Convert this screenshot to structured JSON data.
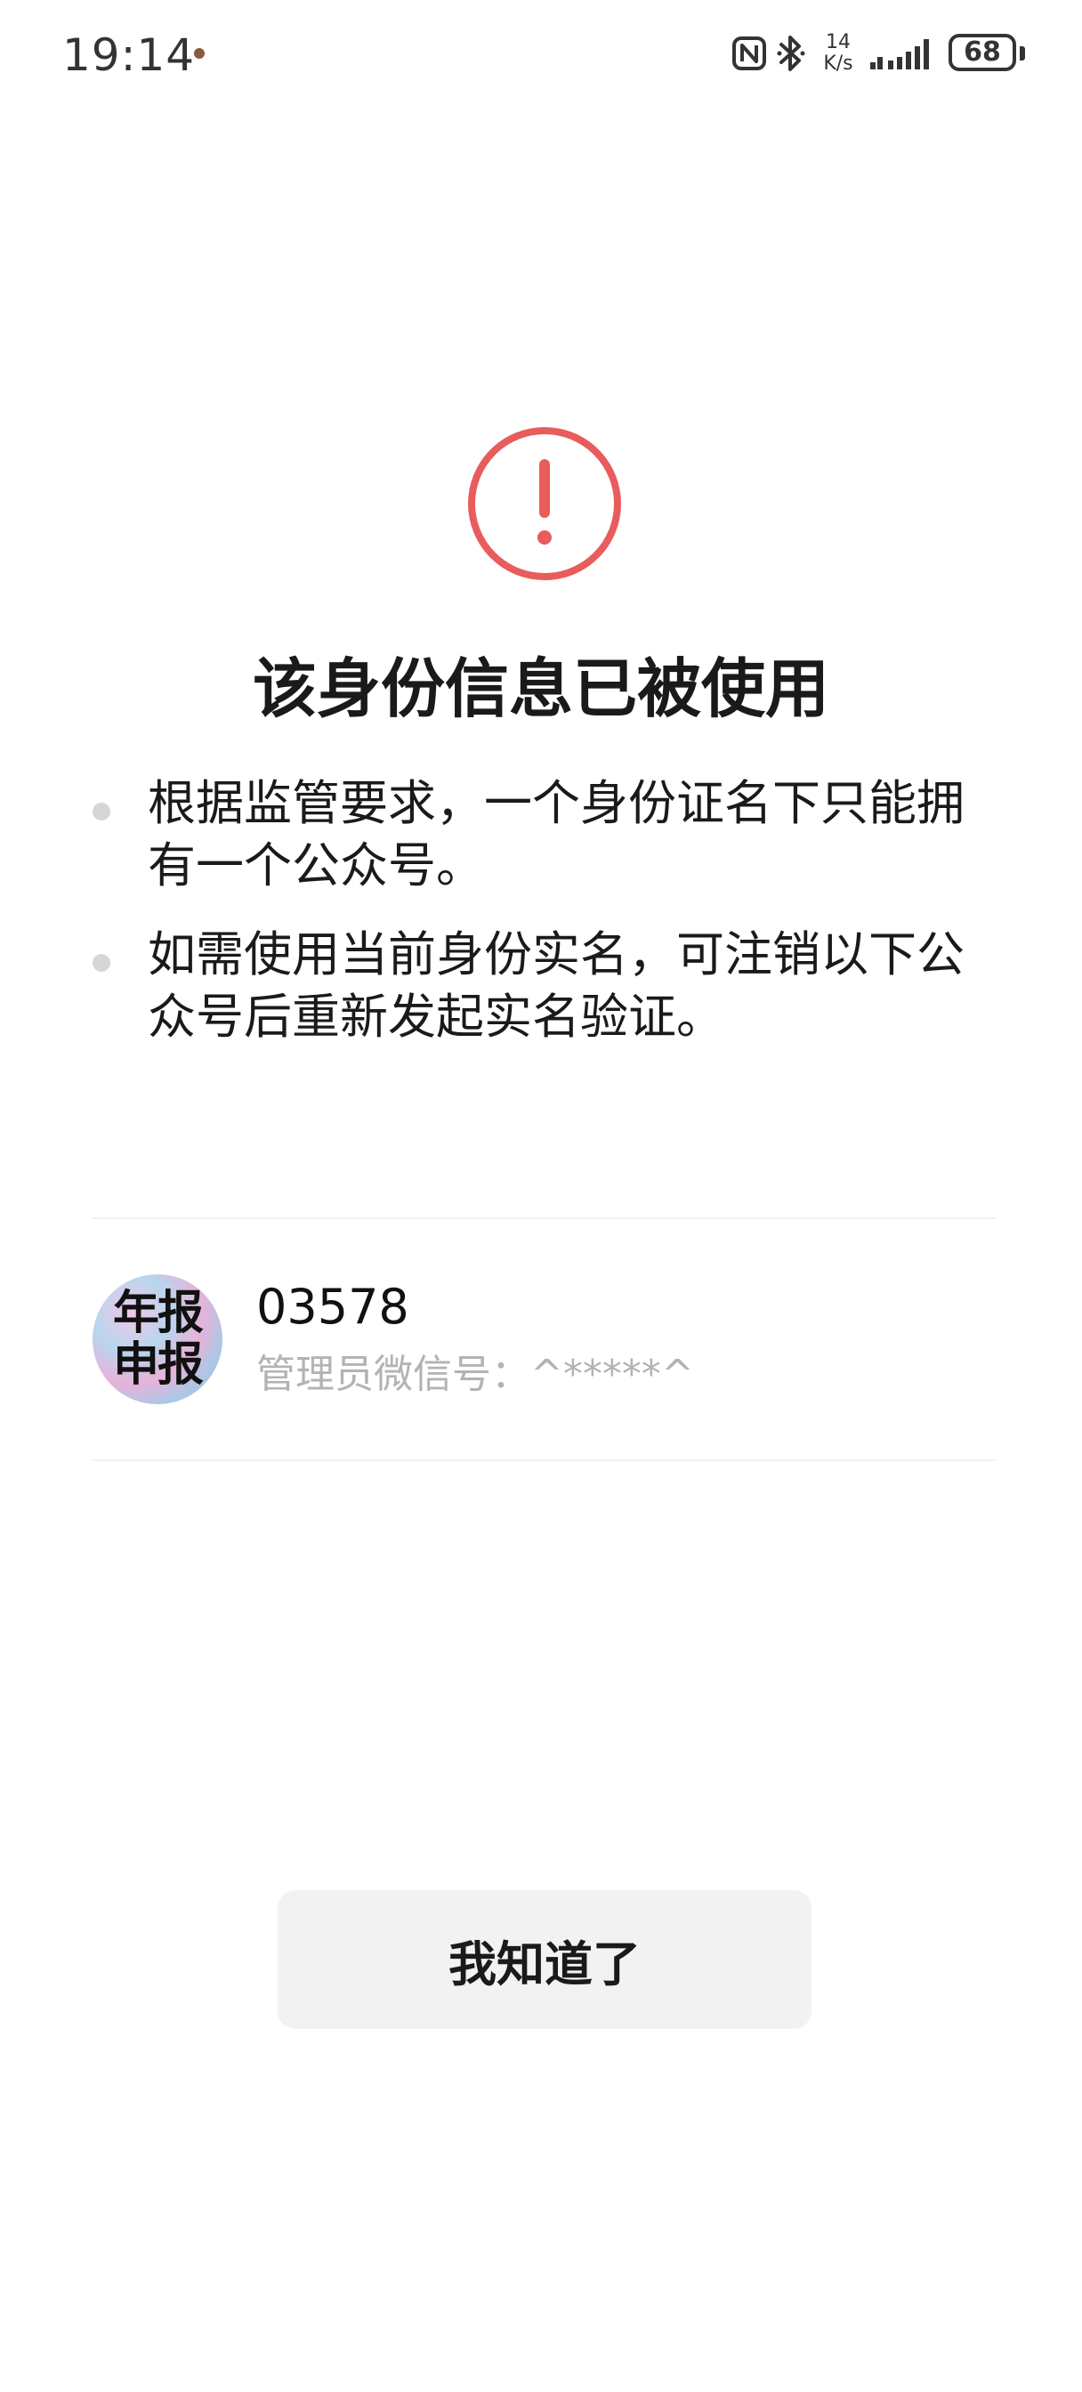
{
  "status_bar": {
    "time": "19:14",
    "net_speed_value": "14",
    "net_speed_unit": "K/s",
    "battery_level": "68"
  },
  "dialog": {
    "title": "该身份信息已被使用",
    "bullets": [
      "根据监管要求，一个身份证名下只能拥有一个公众号。",
      "如需使用当前身份实名，可注销以下公众号后重新发起实名验证。"
    ]
  },
  "account": {
    "avatar_text_line1": "年报",
    "avatar_text_line2": "申报",
    "name": "03578",
    "admin_wechat": "管理员微信号：^*****^"
  },
  "button": {
    "label": "我知道了"
  },
  "colors": {
    "warning": "#E85C5C",
    "button_bg": "#F2F2F2",
    "secondary_text": "#B3B3B3"
  },
  "icons": {
    "status": [
      "nfc-icon",
      "bluetooth-icon",
      "signal-icon",
      "battery-icon"
    ],
    "warning": "exclamation-circle-icon"
  }
}
